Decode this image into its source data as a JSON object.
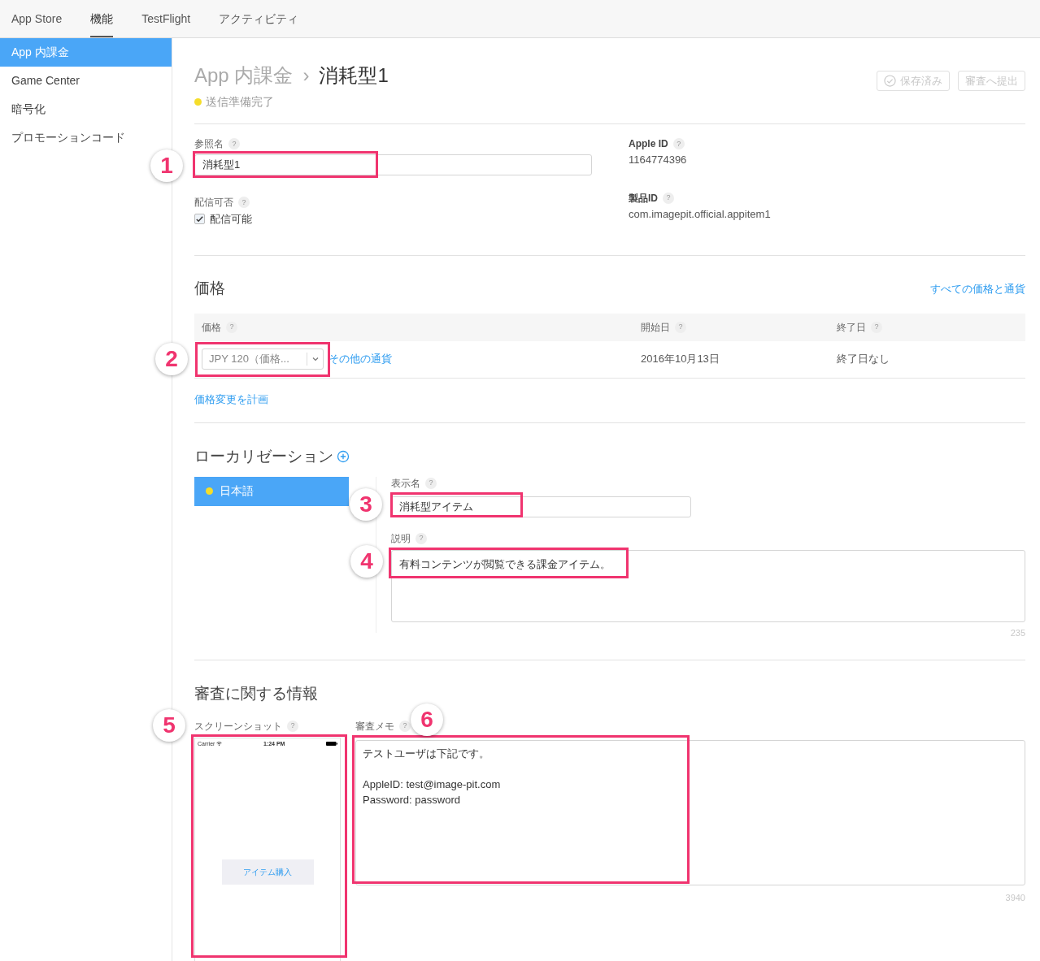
{
  "nav": {
    "tabs": [
      {
        "label": "App Store",
        "selected": false
      },
      {
        "label": "機能",
        "selected": true
      },
      {
        "label": "TestFlight",
        "selected": false
      },
      {
        "label": "アクティビティ",
        "selected": false
      }
    ]
  },
  "sidebar": {
    "items": [
      {
        "label": "App 内課金",
        "selected": true
      },
      {
        "label": "Game Center",
        "selected": false
      },
      {
        "label": "暗号化",
        "selected": false
      },
      {
        "label": "プロモーションコード",
        "selected": false
      }
    ]
  },
  "header": {
    "breadcrumb_parent": "App 内課金",
    "separator": "›",
    "title": "消耗型1",
    "status": {
      "text": "送信準備完了",
      "color": "#f5dd2a"
    },
    "buttons": [
      {
        "label": "保存済み",
        "kind": "saved",
        "disabled": true
      },
      {
        "label": "審査へ提出",
        "kind": "submit",
        "disabled": true
      }
    ]
  },
  "form": {
    "reference_name": {
      "label": "参照名",
      "help": "?",
      "value": "消耗型1"
    },
    "availability": {
      "label": "配信可否",
      "help": "?",
      "checkbox_label": "配信可能",
      "checked": true
    },
    "apple_id": {
      "label": "Apple ID",
      "help": "?",
      "value": "1164774396"
    },
    "product_id": {
      "label": "製品ID",
      "help": "?",
      "value": "com.imagepit.official.appitem1"
    }
  },
  "pricing": {
    "title": "価格",
    "all_link": "すべての価格と通貨",
    "columns": [
      {
        "label": "価格",
        "help": "?"
      },
      {
        "label": "開始日",
        "help": "?"
      },
      {
        "label": "終了日",
        "help": "?"
      }
    ],
    "rows": [
      {
        "price": "JPY 120（価格...",
        "other_link": "その他の通貨",
        "start": "2016年10月13日",
        "end": "終了日なし"
      }
    ],
    "plan_link": "価格変更を計画"
  },
  "localization": {
    "title": "ローカリゼーション",
    "languages": [
      {
        "label": "日本語",
        "selected": true,
        "color": "#f5dd2a"
      }
    ],
    "display_name": {
      "label": "表示名",
      "help": "?",
      "value": "消耗型アイテム"
    },
    "description": {
      "label": "説明",
      "help": "?",
      "value": "有料コンテンツが閲覧できる課金アイテム。",
      "counter": "235"
    }
  },
  "review": {
    "title": "審査に関する情報",
    "screenshot": {
      "label": "スクリーンショット",
      "help": "?",
      "carrier": "Carrier",
      "time": "1:24 PM",
      "button": "アイテム購入"
    },
    "notes": {
      "label": "審査メモ",
      "help": "?",
      "value": "テストユーザは下記です。\n\nAppleID: test@image-pit.com\nPassword: password",
      "counter": "3940"
    }
  },
  "annotations": [
    {
      "number": "1"
    },
    {
      "number": "2"
    },
    {
      "number": "3"
    },
    {
      "number": "4"
    },
    {
      "number": "5"
    },
    {
      "number": "6"
    }
  ]
}
